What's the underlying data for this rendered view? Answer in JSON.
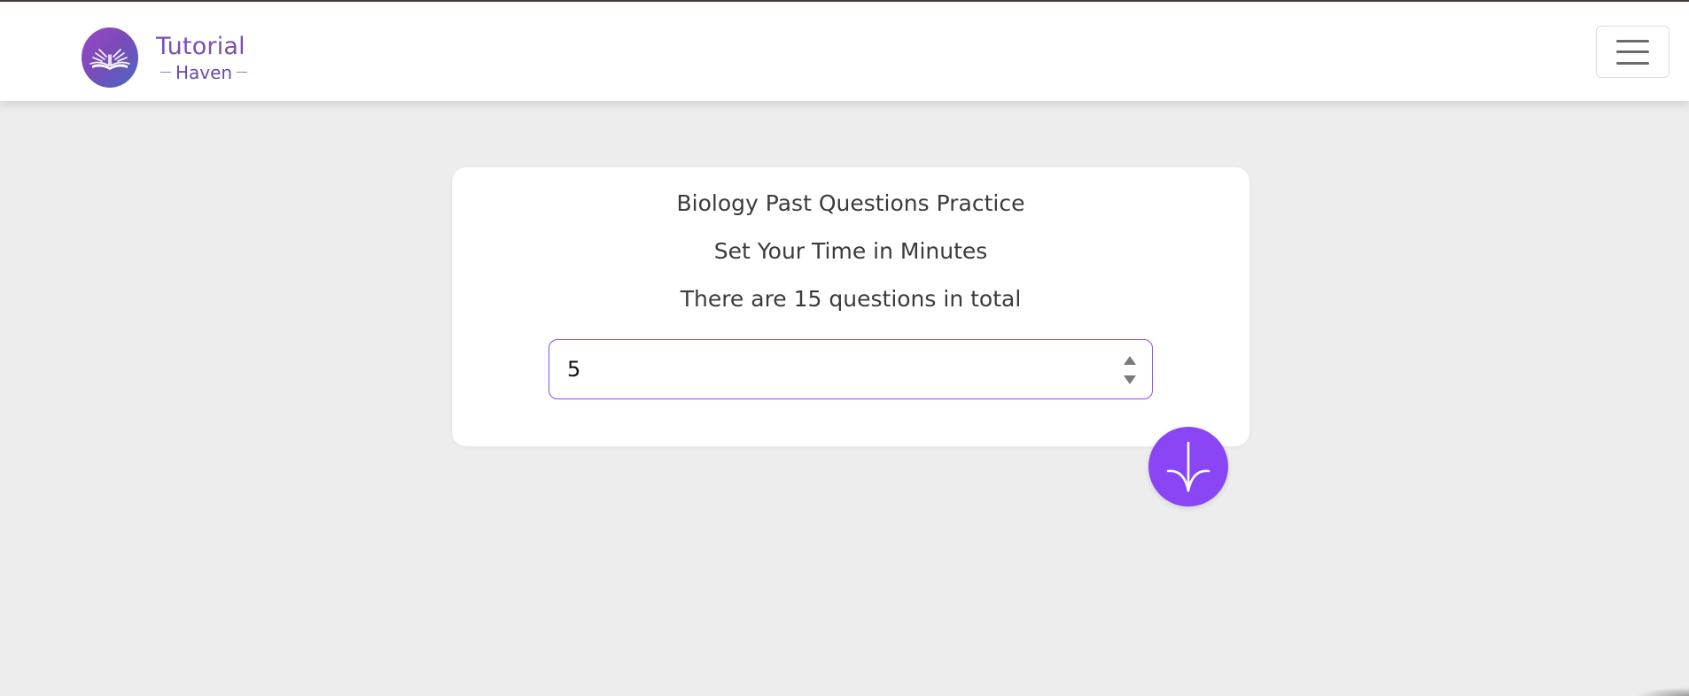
{
  "brand": {
    "name": "Tutorial",
    "sub": "Haven",
    "logo_icon": "open-book-icon"
  },
  "nav": {
    "menu_icon": "hamburger-menu-icon"
  },
  "practice": {
    "title": "Biology Past Questions Practice",
    "instruction": "Set Your Time in Minutes",
    "question_count_text": "There are 15 questions in total",
    "minutes_value": "5"
  },
  "fab": {
    "icon": "sprout-arrow-icon"
  },
  "colors": {
    "accent": "#8a46f5",
    "page_background": "#ededed",
    "brand_text": "#7a4fb0"
  }
}
